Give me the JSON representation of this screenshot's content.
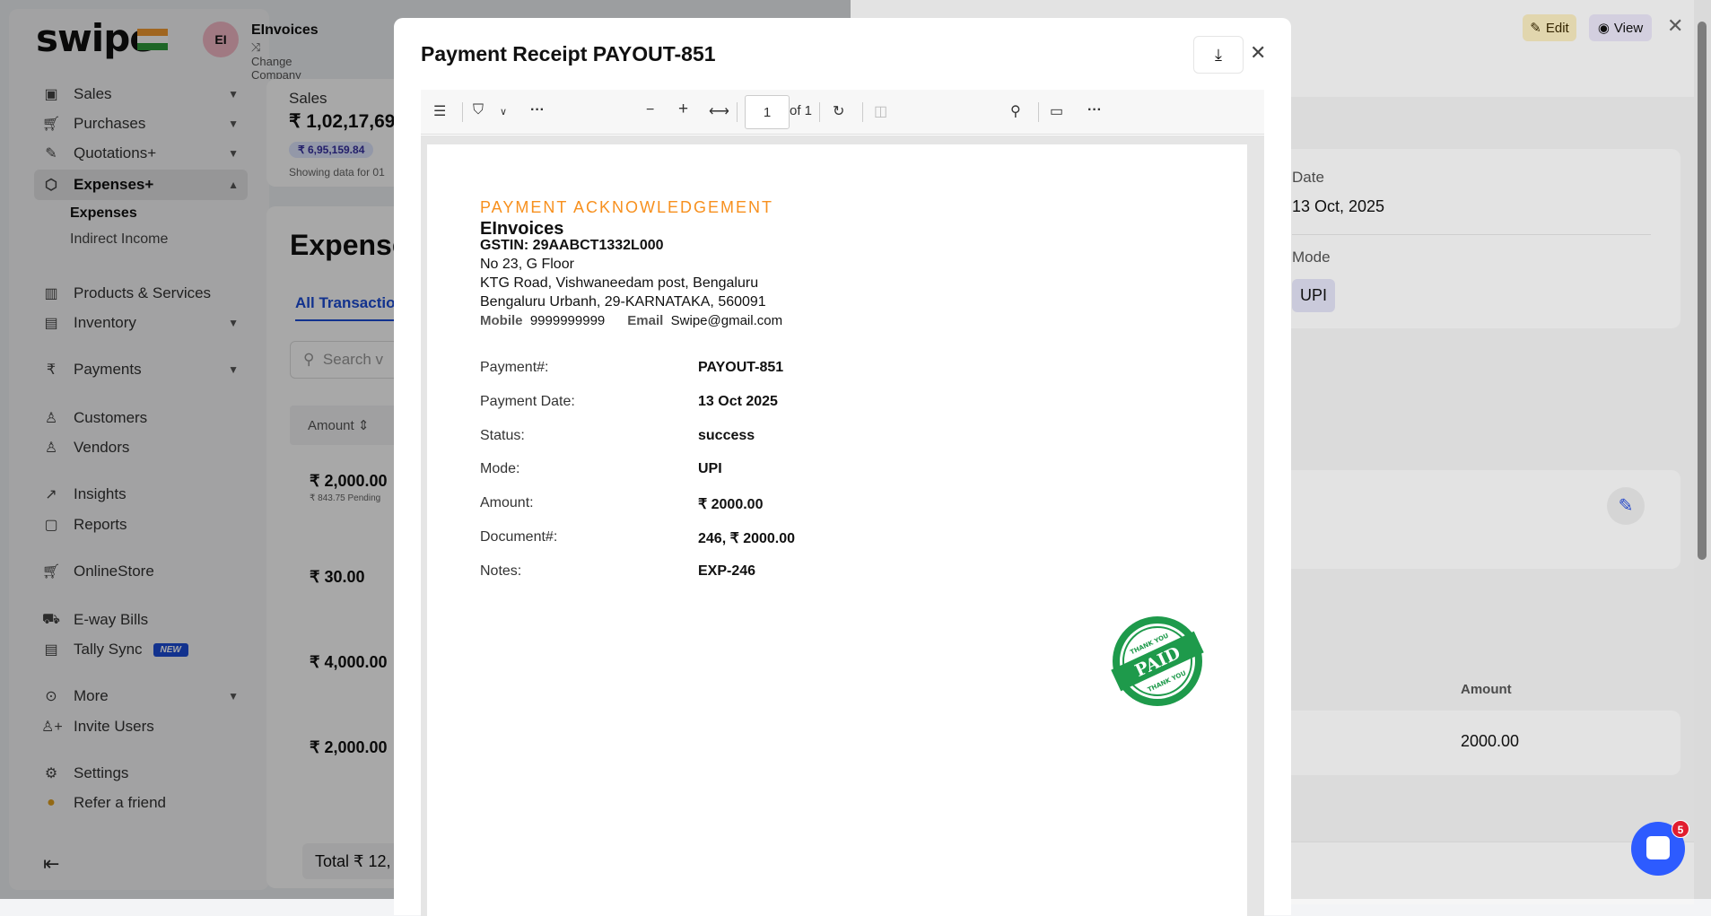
{
  "app": {
    "logo": "swipe",
    "company": {
      "initials": "EI",
      "name": "EInvoices",
      "change": "Change Company"
    }
  },
  "sidebar": {
    "items": [
      {
        "label": "Sales",
        "icon": "cash-icon"
      },
      {
        "label": "Purchases",
        "icon": "cart-icon"
      },
      {
        "label": "Quotations+",
        "icon": "pencil-icon"
      },
      {
        "label": "Expenses+",
        "icon": "tag-icon"
      },
      {
        "label": "Products & Services",
        "icon": "barcode-icon"
      },
      {
        "label": "Inventory",
        "icon": "warehouse-icon"
      },
      {
        "label": "Payments",
        "icon": "rupee-icon"
      },
      {
        "label": "Customers",
        "icon": "user-icon"
      },
      {
        "label": "Vendors",
        "icon": "users-icon"
      },
      {
        "label": "Insights",
        "icon": "chart-icon"
      },
      {
        "label": "Reports",
        "icon": "report-icon"
      },
      {
        "label": "OnlineStore",
        "icon": "store-icon"
      },
      {
        "label": "E-way Bills",
        "icon": "truck-icon"
      },
      {
        "label": "Tally Sync",
        "icon": "doc-icon"
      },
      {
        "label": "More",
        "icon": "more-icon"
      },
      {
        "label": "Invite Users",
        "icon": "user-plus-icon"
      },
      {
        "label": "Settings",
        "icon": "gear-icon"
      },
      {
        "label": "Refer a friend",
        "icon": "gift-icon"
      }
    ],
    "sub": [
      "Expenses",
      "Indirect Income"
    ],
    "new_badge": "NEW"
  },
  "main": {
    "sales_label": "Sales",
    "sales_value": "₹ 1,02,17,69",
    "sales_badge": "₹ 6,95,159.84",
    "sales_note": "Showing data for 01",
    "title": "Expense",
    "tab": "All Transactio",
    "search": "Search v",
    "col": "Amount",
    "rows": [
      {
        "amount": "₹ 2,000.00",
        "note": "₹ 843.75 Pending"
      },
      {
        "amount": "₹ 30.00"
      },
      {
        "amount": "₹ 4,000.00"
      },
      {
        "amount": "₹ 2,000.00"
      }
    ],
    "total": "Total ₹ 12,"
  },
  "drawer": {
    "edit": "Edit",
    "view": "View",
    "date_label": "Date",
    "date": "13 Oct, 2025",
    "mode_label": "Mode",
    "mode": "UPI",
    "amount_label": "Amount",
    "amount": "2000.00",
    "chat_badge": "5"
  },
  "modal": {
    "title": "Payment Receipt PAYOUT-851",
    "page": "1",
    "page_of": "of 1",
    "receipt": {
      "heading": "PAYMENT ACKNOWLEDGEMENT",
      "company": "EInvoices",
      "gstin": "GSTIN: 29AABCT1332L000",
      "address": [
        "No 23, G Floor",
        "KTG Road, Vishwaneedam post, Bengaluru",
        "Bengaluru Urbanh, 29-KARNATAKA, 560091"
      ],
      "mobile_label": "Mobile",
      "mobile": "9999999999",
      "email_label": "Email",
      "email": "Swipe@gmail.com",
      "fields": [
        {
          "label": "Payment#:",
          "value": "PAYOUT-851"
        },
        {
          "label": "Payment Date:",
          "value": "13 Oct 2025"
        },
        {
          "label": "Status:",
          "value": "success"
        },
        {
          "label": "Mode:",
          "value": "UPI"
        },
        {
          "label": "Amount:",
          "value": "₹ 2000.00"
        },
        {
          "label": "Document#:",
          "value": "246, ₹ 2000.00"
        },
        {
          "label": "Notes:",
          "value": "EXP-246"
        }
      ],
      "stamp": {
        "text": "PAID",
        "ring": "THANK YOU"
      }
    }
  },
  "colors": {
    "accent": "#f7901e",
    "primary": "#1d4ed8",
    "stamp": "#1e9a4b",
    "chat": "#2d5bff"
  }
}
